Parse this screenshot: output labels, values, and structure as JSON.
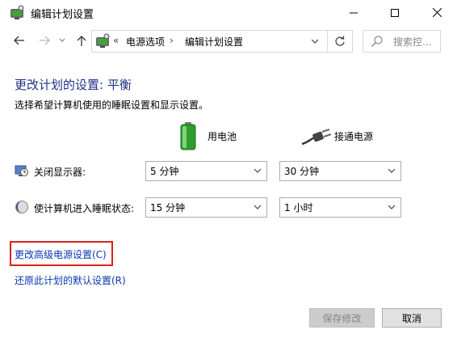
{
  "window": {
    "title": "编辑计划设置"
  },
  "nav": {
    "breadcrumb_prefix": "«",
    "segments": [
      "电源选项",
      "编辑计划设置"
    ],
    "separator": "›",
    "search_placeholder": "搜索控..."
  },
  "content": {
    "title": "更改计划的设置: 平衡",
    "description": "选择希望计算机使用的睡眠设置和显示设置。",
    "columns": {
      "battery": "用电池",
      "plugged_in": "接通电源"
    },
    "rows": [
      {
        "label": "关闭显示器:",
        "battery_value": "5 分钟",
        "plugged_value": "30 分钟"
      },
      {
        "label": "使计算机进入睡眠状态:",
        "battery_value": "15 分钟",
        "plugged_value": "1 小时"
      }
    ],
    "links": {
      "advanced": "更改高级电源设置(C)",
      "restore": "还原此计划的默认设置(R)"
    }
  },
  "buttons": {
    "save": "保存修改",
    "cancel": "取消"
  },
  "colors": {
    "title_blue": "#1e3287",
    "link_blue": "#0a36b4",
    "highlight_red": "#e02020"
  }
}
